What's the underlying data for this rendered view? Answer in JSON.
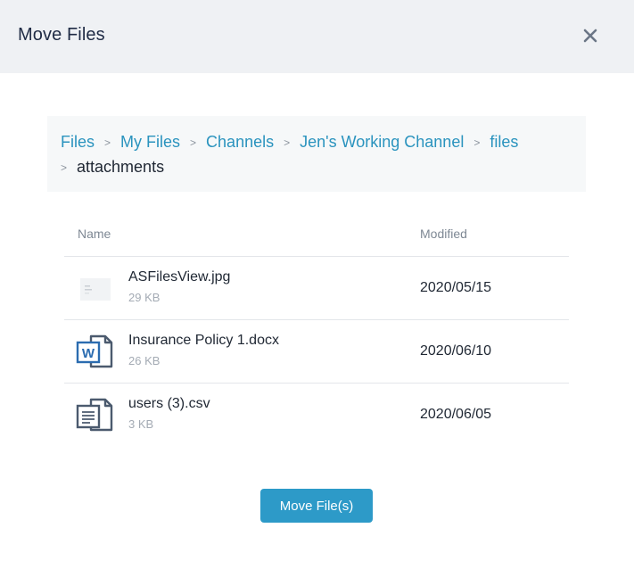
{
  "dialog": {
    "title": "Move Files",
    "close_icon": "close-icon"
  },
  "breadcrumb": {
    "items": [
      "Files",
      "My Files",
      "Channels",
      "Jen's Working Channel",
      "files"
    ],
    "current": "attachments",
    "separator": ">"
  },
  "table": {
    "headers": {
      "name": "Name",
      "modified": "Modified"
    },
    "rows": [
      {
        "name": "ASFilesView.jpg",
        "size": "29 KB",
        "modified": "2020/05/15",
        "icon": "image-thumbnail-icon"
      },
      {
        "name": "Insurance Policy 1.docx",
        "size": "26 KB",
        "modified": "2020/06/10",
        "icon": "word-document-icon"
      },
      {
        "name": "users (3).csv",
        "size": "3 KB",
        "modified": "2020/06/05",
        "icon": "csv-file-icon"
      }
    ]
  },
  "actions": {
    "move_label": "Move File(s)"
  },
  "colors": {
    "accent": "#2d9ac8",
    "link": "#2a93be",
    "header_bg": "#eff1f4",
    "icon_blue": "#2b6cb0",
    "icon_slate": "#4b5a6e"
  }
}
